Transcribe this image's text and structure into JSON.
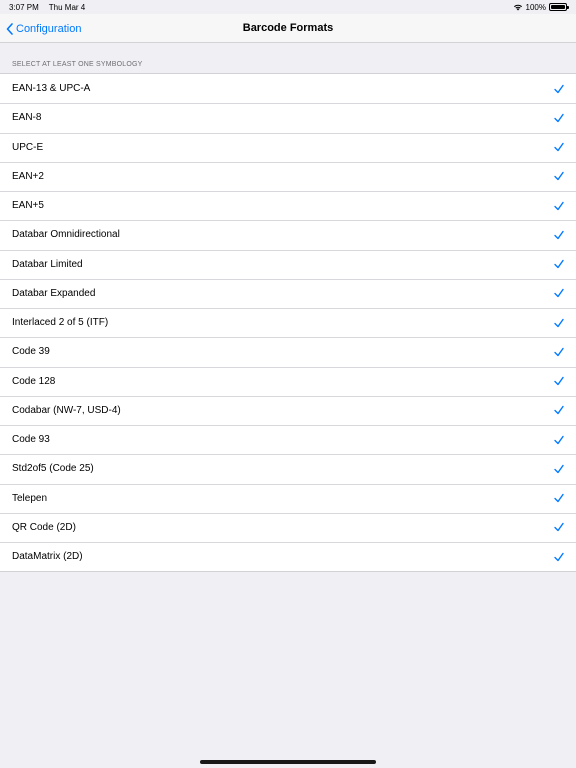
{
  "status": {
    "time": "3:07 PM",
    "date": "Thu Mar 4",
    "battery": "100%",
    "battery_level": 1.0
  },
  "nav": {
    "back_label": "Configuration",
    "title": "Barcode Formats"
  },
  "section": {
    "header": "SELECT AT LEAST ONE SYMBOLOGY"
  },
  "accent_color": "#007aff",
  "symbologies": [
    {
      "label": "EAN-13 & UPC-A",
      "checked": true
    },
    {
      "label": "EAN-8",
      "checked": true
    },
    {
      "label": "UPC-E",
      "checked": true
    },
    {
      "label": "EAN+2",
      "checked": true
    },
    {
      "label": "EAN+5",
      "checked": true
    },
    {
      "label": "Databar Omnidirectional",
      "checked": true
    },
    {
      "label": "Databar Limited",
      "checked": true
    },
    {
      "label": "Databar Expanded",
      "checked": true
    },
    {
      "label": "Interlaced 2 of 5 (ITF)",
      "checked": true
    },
    {
      "label": "Code 39",
      "checked": true
    },
    {
      "label": "Code 128",
      "checked": true
    },
    {
      "label": "Codabar (NW-7, USD-4)",
      "checked": true
    },
    {
      "label": "Code 93",
      "checked": true
    },
    {
      "label": "Std2of5 (Code 25)",
      "checked": true
    },
    {
      "label": "Telepen",
      "checked": true
    },
    {
      "label": "QR Code (2D)",
      "checked": true
    },
    {
      "label": "DataMatrix (2D)",
      "checked": true
    }
  ]
}
